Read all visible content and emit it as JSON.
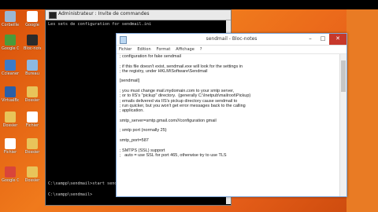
{
  "desktop_icons": [
    {
      "label": "Corbeille",
      "color": "#9bb7d4"
    },
    {
      "label": "Google",
      "color": "#ffffff"
    },
    {
      "label": "Google Chrome",
      "color": "#4a9b3a"
    },
    {
      "label": "Bloc-notes",
      "color": "#2b2b2b"
    },
    {
      "label": "Ccleaner",
      "color": "#3a7bc8"
    },
    {
      "label": "Bureau",
      "color": "#8cb8e0"
    },
    {
      "label": "VirtualBox",
      "color": "#2a5fa8"
    },
    {
      "label": "Dossier",
      "color": "#e8c45a"
    },
    {
      "label": "Dossier",
      "color": "#e8c45a"
    },
    {
      "label": "Fichier",
      "color": "#ffffff"
    },
    {
      "label": "Fichier",
      "color": "#ffffff"
    },
    {
      "label": "Dossier",
      "color": "#e8c45a"
    },
    {
      "label": "Google Chrome",
      "color": "#d9453a"
    },
    {
      "label": "Dossier",
      "color": "#e8c45a"
    }
  ],
  "cmd": {
    "title": "Administrateur : Invite de commandes",
    "lines": [
      "Les sets de configuration for sendmail.ini",
      "",
      "C:\\xampp\\sendmail>start sendmail.ini",
      "",
      "C:\\xampp\\sendmail>"
    ]
  },
  "notepad": {
    "title": "sendmail - Bloc-notes",
    "menu": [
      "Fichier",
      "Edition",
      "Format",
      "Affichage",
      "?"
    ],
    "lines": [
      "; configuration for fake sendmail",
      "",
      "; if this file doesn't exist, sendmail.exe will look for the settings in",
      "; the registry, under HKLM\\Software\\Sendmail",
      "",
      "[sendmail]",
      "",
      "; you must change mail.mydomain.com to your smtp server,",
      "; or to IIS's \"pickup\" directory.  (generally C:\\Inetpub\\mailroot\\Pickup)",
      "; emails delivered via IIS's pickup directory cause sendmail to",
      "; run quicker, but you won't get error messages back to the calling",
      "; application.",
      "",
      "smtp_server=smtp.gmail.com///configuration gmail",
      "",
      "; smtp port (normally 25)",
      "",
      "smtp_port=587",
      "",
      "; SMTPS (SSL) support",
      ";   auto = use SSL for port 465, otherwise try to use TLS"
    ]
  }
}
